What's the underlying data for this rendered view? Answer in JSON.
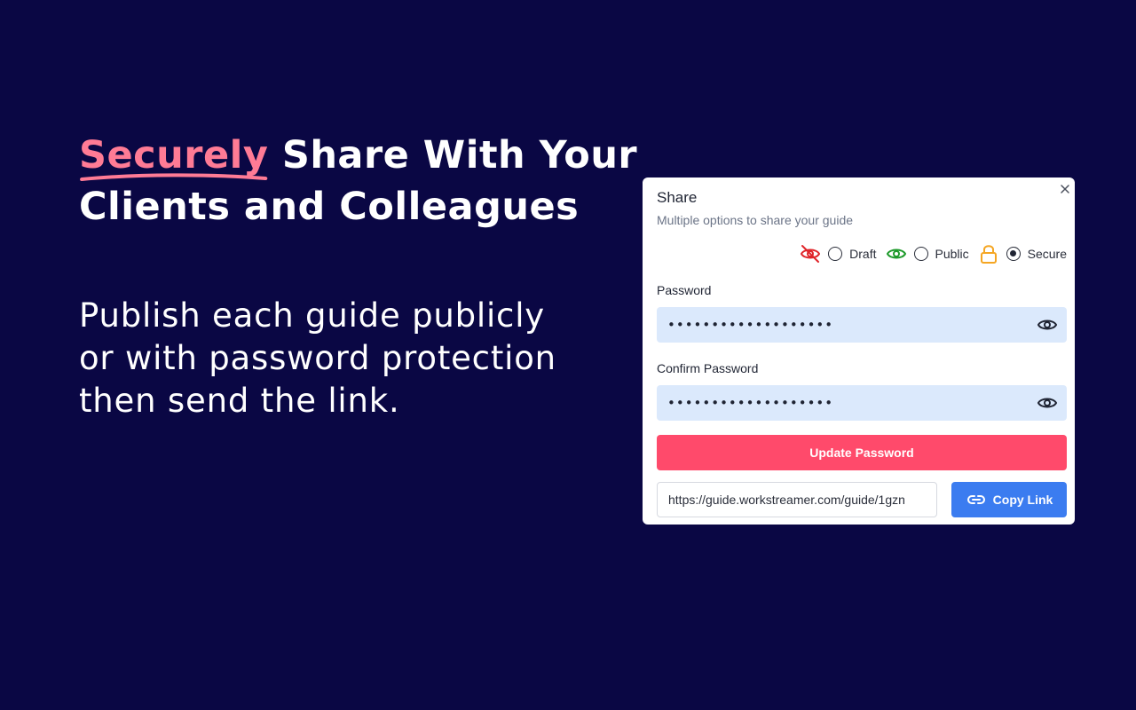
{
  "headline": {
    "accent_word": "Securely",
    "rest_line1": " Share With Your",
    "line2": "Clients and Colleagues"
  },
  "subcopy": {
    "line1": "Publish each guide publicly",
    "line2": "or with password protection",
    "line3": "then send the link."
  },
  "dialog": {
    "title": "Share",
    "subtitle": "Multiple options to share your guide",
    "close_icon": "close-icon",
    "visibility_options": [
      {
        "label": "Draft",
        "icon": "eye-off-icon",
        "icon_color": "#e0262b",
        "checked": false
      },
      {
        "label": "Public",
        "icon": "eye-icon",
        "icon_color": "#1e9a2b",
        "checked": false
      },
      {
        "label": "Secure",
        "icon": "lock-icon",
        "icon_color": "#f5a623",
        "checked": true
      }
    ],
    "password": {
      "label": "Password",
      "value": "•••••••••••••••••••"
    },
    "confirm_password": {
      "label": "Confirm Password",
      "value": "•••••••••••••••••••"
    },
    "update_button_label": "Update Password",
    "share_link": "https://guide.workstreamer.com/guide/1gzn",
    "copy_button_label": "Copy Link"
  },
  "colors": {
    "background": "#0a0744",
    "accent_pink": "#ff7b95",
    "update_button": "#ff4a6b",
    "copy_button": "#3b7cf0",
    "input_fill": "#dbe9fc"
  }
}
